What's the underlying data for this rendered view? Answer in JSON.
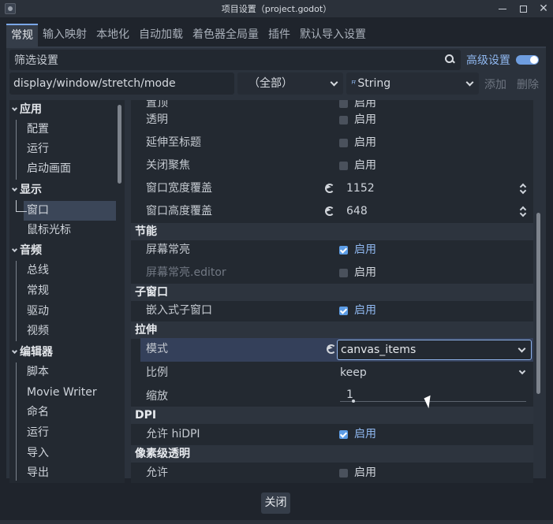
{
  "window": {
    "title": "项目设置（project.godot）"
  },
  "tabs": [
    "常规",
    "输入映射",
    "本地化",
    "自动加载",
    "着色器全局量",
    "插件",
    "默认导入设置"
  ],
  "filter": {
    "placeholder": "筛选设置",
    "advanced_label": "高级设置",
    "advanced_enabled": true
  },
  "path_row": {
    "path": "display/window/stretch/mode",
    "scope": "（全部）",
    "type_icon": "string-type-icon",
    "type": "String",
    "add": "添加",
    "delete": "删除"
  },
  "tree": [
    {
      "label": "应用",
      "level": 0
    },
    {
      "label": "配置",
      "level": 1
    },
    {
      "label": "运行",
      "level": 1
    },
    {
      "label": "启动画面",
      "level": 1
    },
    {
      "label": "显示",
      "level": 0
    },
    {
      "label": "窗口",
      "level": 1,
      "selected": true
    },
    {
      "label": "鼠标光标",
      "level": 1
    },
    {
      "label": "音频",
      "level": 0
    },
    {
      "label": "总线",
      "level": 1
    },
    {
      "label": "常规",
      "level": 1
    },
    {
      "label": "驱动",
      "level": 1
    },
    {
      "label": "视频",
      "level": 1
    },
    {
      "label": "编辑器",
      "level": 0
    },
    {
      "label": "脚本",
      "level": 1
    },
    {
      "label": "Movie Writer",
      "level": 1
    },
    {
      "label": "命名",
      "level": 1
    },
    {
      "label": "运行",
      "level": 1
    },
    {
      "label": "导入",
      "level": 1
    },
    {
      "label": "导出",
      "level": 1
    }
  ],
  "properties": {
    "enabled_text": "启用",
    "always_on_top": {
      "label": "置顶",
      "checked": false
    },
    "transparent": {
      "label": "透明",
      "checked": false
    },
    "extend_to_title": {
      "label": "延伸至标题",
      "checked": false
    },
    "no_focus": {
      "label": "关闭聚焦",
      "checked": false
    },
    "width_override": {
      "label": "窗口宽度覆盖",
      "value": "1152"
    },
    "height_override": {
      "label": "窗口高度覆盖",
      "value": "648"
    },
    "energy_section": "节能",
    "keep_screen_on": {
      "label": "屏幕常亮",
      "checked": true
    },
    "keep_screen_on_editor": {
      "label": "屏幕常亮.editor",
      "checked": false
    },
    "subwindows_section": "子窗口",
    "embed_subwindows": {
      "label": "嵌入式子窗口",
      "checked": true
    },
    "stretch_section": "拉伸",
    "mode": {
      "label": "模式",
      "value": "canvas_items"
    },
    "aspect": {
      "label": "比例",
      "value": "keep"
    },
    "scale": {
      "label": "缩放",
      "value": "1"
    },
    "dpi_section": "DPI",
    "allow_hidpi": {
      "label": "允许 hiDPI",
      "checked": true
    },
    "transparency_section": "像素级透明",
    "allow": {
      "label": "允许",
      "checked": false
    }
  },
  "footer": {
    "close": "关闭"
  },
  "colors": {
    "accent": "#8fb7ef",
    "checkbox_on": "#5d9de6",
    "background": "#1f242c"
  }
}
